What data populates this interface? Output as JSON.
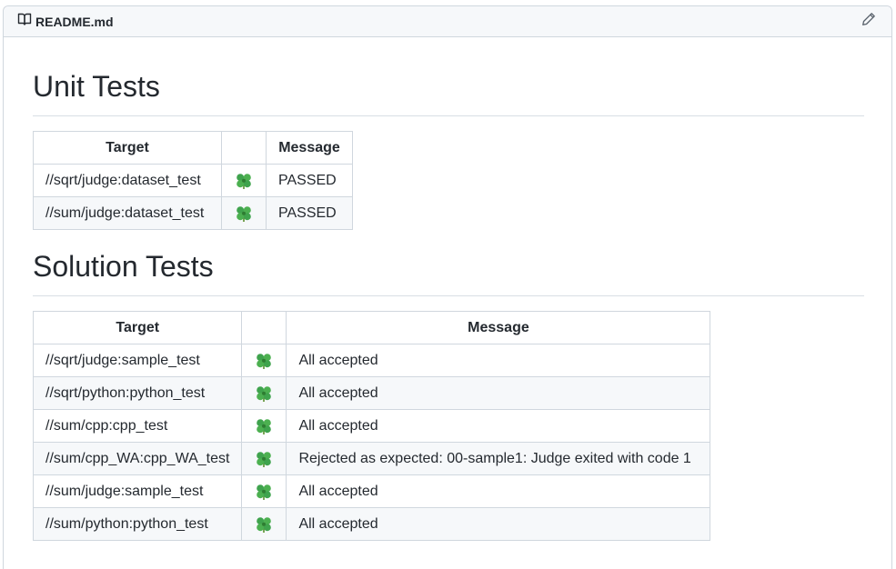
{
  "file": {
    "icon": "book-icon",
    "name": "README.md",
    "edit_icon": "pencil-icon"
  },
  "unit_tests": {
    "heading": "Unit Tests",
    "headers": [
      "Target",
      "",
      "Message"
    ],
    "rows": [
      {
        "target": "//sqrt/judge:dataset_test",
        "icon": "four-leaf-clover-icon",
        "message": "PASSED"
      },
      {
        "target": "//sum/judge:dataset_test",
        "icon": "four-leaf-clover-icon",
        "message": "PASSED"
      }
    ]
  },
  "solution_tests": {
    "heading": "Solution Tests",
    "headers": [
      "Target",
      "",
      "Message"
    ],
    "rows": [
      {
        "target": "//sqrt/judge:sample_test",
        "icon": "four-leaf-clover-icon",
        "message": "All accepted"
      },
      {
        "target": "//sqrt/python:python_test",
        "icon": "four-leaf-clover-icon",
        "message": "All accepted"
      },
      {
        "target": "//sum/cpp:cpp_test",
        "icon": "four-leaf-clover-icon",
        "message": "All accepted"
      },
      {
        "target": "//sum/cpp_WA:cpp_WA_test",
        "icon": "four-leaf-clover-icon",
        "message": "Rejected as expected: 00-sample1: Judge exited with code 1"
      },
      {
        "target": "//sum/judge:sample_test",
        "icon": "four-leaf-clover-icon",
        "message": "All accepted"
      },
      {
        "target": "//sum/python:python_test",
        "icon": "four-leaf-clover-icon",
        "message": "All accepted"
      }
    ]
  },
  "colors": {
    "border": "#d0d7de",
    "header_bg": "#f6f8fa",
    "text": "#24292f",
    "clover_green": "#3fa34d"
  }
}
